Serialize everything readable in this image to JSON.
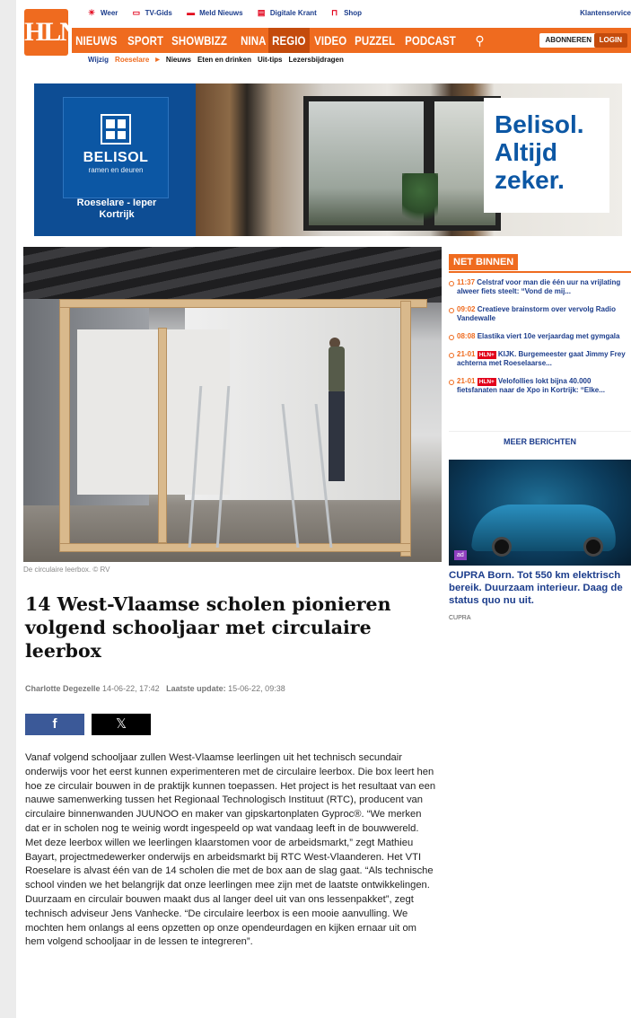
{
  "header": {
    "logo": "HLN",
    "utility": [
      {
        "label": "Weer",
        "icon": "weather-icon"
      },
      {
        "label": "TV-Gids",
        "icon": "tv-icon"
      },
      {
        "label": "Meld Nieuws",
        "icon": "report-icon"
      },
      {
        "label": "Digitale Krant",
        "icon": "newspaper-icon"
      },
      {
        "label": "Shop",
        "icon": "cart-icon"
      }
    ],
    "customer_service": "Klantenservice",
    "nav": [
      "NIEUWS",
      "SPORT",
      "SHOWBIZZ",
      "NINA",
      "REGIO",
      "VIDEO",
      "PUZZEL",
      "PODCAST"
    ],
    "active_nav": "REGIO",
    "subscribe": "ABONNEREN",
    "login": "LOGIN",
    "subnav": {
      "edit": "Wijzig",
      "city": "Roeselare",
      "items": [
        "Nieuws",
        "Eten en drinken",
        "Uit-tips",
        "Lezersbijdragen"
      ]
    }
  },
  "banner_ad": {
    "brand": "BELISOL",
    "tagline": "ramen en deuren",
    "location": "Roeselare - Ieper Kortrijk",
    "slogan_1": "Belisol.",
    "slogan_2": "Altijd",
    "slogan_3": "zeker."
  },
  "article": {
    "caption": "De circulaire leerbox. © RV",
    "title": "14 West-Vlaamse scholen pionieren volgend schooljaar met circulaire leerbox",
    "author": "Charlotte Degezelle",
    "date": "14-06-22, 17:42",
    "update_label": "Laatste update:",
    "update": "15-06-22, 09:38",
    "share_fb": "f",
    "share_x": "𝕏",
    "body": "Vanaf volgend schooljaar zullen West-Vlaamse leerlingen uit het technisch secundair onderwijs voor het eerst kunnen experimenteren met de circulaire leerbox. Die box leert hen hoe ze circulair bouwen in de praktijk kunnen toepassen. Het project is het resultaat van een nauwe samenwerking tussen het Regionaal Technologisch Instituut (RTC), producent van circulaire binnenwanden JUUNOO en maker van gipskartonplaten Gyproc®. “We merken dat er in scholen nog te weinig wordt ingespeeld op wat vandaag leeft in de bouwwereld. Met deze leerbox willen we leerlingen klaarstomen voor de arbeidsmarkt,” zegt Mathieu Bayart, projectmedewerker onderwijs en arbeidsmarkt bij RTC West-Vlaanderen. Het VTI Roeselare is alvast één van de 14 scholen die met de box aan de slag gaat. “Als technische school vinden we het belangrijk dat onze leerlingen mee zijn met de laatste ontwikkelingen. Duurzaam en circulair bouwen maakt dus al langer deel uit van ons lessenpakket”, zegt technisch adviseur Jens Vanhecke. “De circulaire leerbox is een mooie aanvulling. We mochten hem onlangs al eens opzetten op onze opendeurdagen en kijken ernaar uit om hem volgend schooljaar in de lessen te integreren”."
  },
  "sidebar": {
    "title": "NET BINNEN",
    "items": [
      {
        "time": "11:37",
        "plus": "",
        "text": "Celstraf voor man die één uur na vrijlating alweer fiets steelt: “Vond de mij..."
      },
      {
        "time": "09:02",
        "plus": "",
        "text": "Creatieve brainstorm over vervolg Radio Vandewalle"
      },
      {
        "time": "08:08",
        "plus": "",
        "text": "Elastika viert 10e verjaardag met gymgala"
      },
      {
        "time": "21-01",
        "plus": "HLN+",
        "text": "KIJK. Burgemeester gaat Jimmy Frey achterna met Roeselaarse..."
      },
      {
        "time": "21-01",
        "plus": "HLN+",
        "text": "Velofollies lokt bijna 40.000 fietsfanaten naar de Xpo in Kortrijk: “Elke..."
      }
    ],
    "more": "MEER BERICHTEN",
    "ad_badge": "ad",
    "ad_text": "CUPRA Born. Tot 550 km elektrisch bereik. Duurzaam interieur. Daag de status quo nu uit.",
    "ad_source": "CUPRA"
  },
  "colors": {
    "brand": "#ef6b1f",
    "link": "#1c3d8c",
    "hln_plus": "#e2001a"
  }
}
